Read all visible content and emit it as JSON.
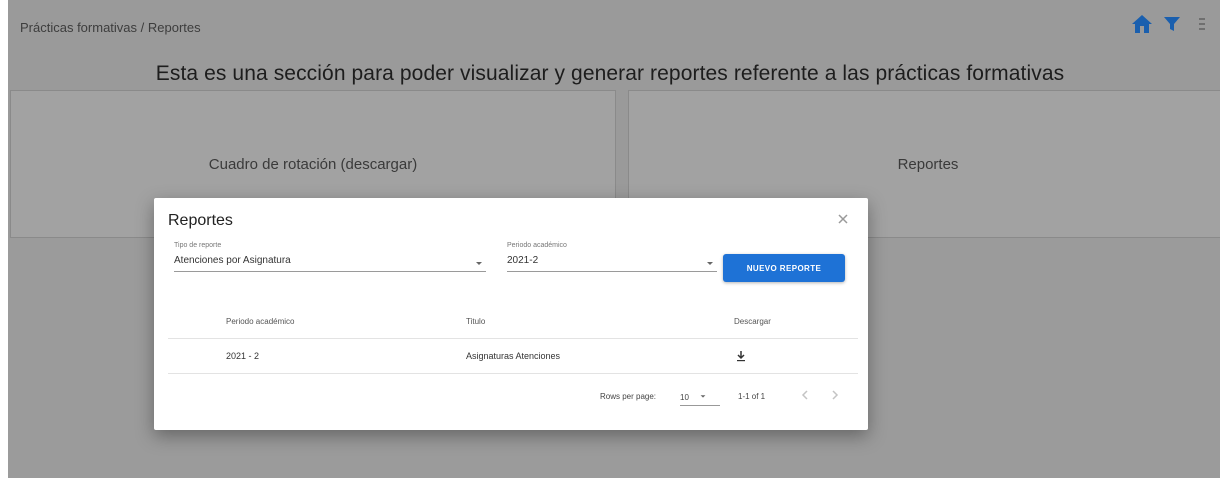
{
  "breadcrumb": "Prácticas formativas / Reportes",
  "heading": "Esta es una sección para poder visualizar y generar reportes referente a las prácticas formativas",
  "cards": {
    "left_label": "Cuadro de rotación (descargar)",
    "right_label": "Reportes"
  },
  "modal": {
    "title": "Reportes",
    "report_type": {
      "label": "Tipo de reporte",
      "value": "Atenciones por Asignatura"
    },
    "period": {
      "label": "Periodo académico",
      "value": "2021-2"
    },
    "new_report_button": "NUEVO REPORTE",
    "table": {
      "headers": [
        "Periodo académico",
        "Titulo",
        "Descargar"
      ],
      "rows": [
        {
          "period": "2021 - 2",
          "title": "Asignaturas Atenciones"
        }
      ]
    },
    "footer": {
      "rows_per_page_label": "Rows per page:",
      "rows_per_page_value": "10",
      "range": "1-1 of 1"
    }
  },
  "colors": {
    "primary": "#1e72d6",
    "overlay": "#9a9a9a"
  },
  "icons": [
    "home-icon",
    "filter-icon",
    "close-icon",
    "download-icon",
    "chevron-left-icon",
    "chevron-right-icon"
  ]
}
